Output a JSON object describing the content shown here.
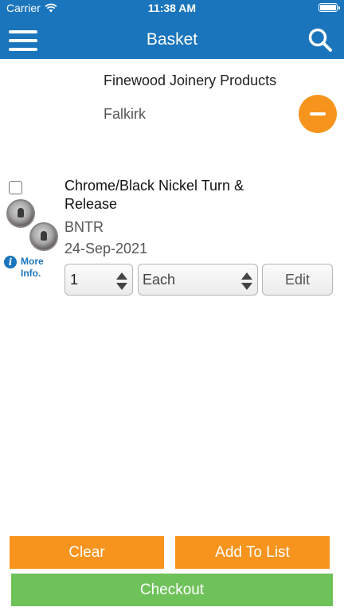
{
  "status_bar": {
    "carrier": "Carrier",
    "time": "11:38 AM",
    "battery_level": 1.0
  },
  "nav": {
    "title": "Basket",
    "menu_icon": "hamburger-menu-icon",
    "search_icon": "search-icon"
  },
  "customer": {
    "name": "Finewood Joinery Products",
    "town": "Falkirk"
  },
  "items": [
    {
      "checked": false,
      "description": "Chrome/Black Nickel Turn & Release",
      "code": "BNTR",
      "date": "24-Sep-2021",
      "more_info": "More Info.",
      "quantity": "1",
      "unit": "Each",
      "edit_label": "Edit"
    }
  ],
  "actions": {
    "clear": "Clear",
    "add_to_list": "Add To List",
    "checkout": "Checkout"
  },
  "colors": {
    "nav_blue": "#1a75bc",
    "orange": "#f7941d",
    "green": "#6fc25a"
  }
}
